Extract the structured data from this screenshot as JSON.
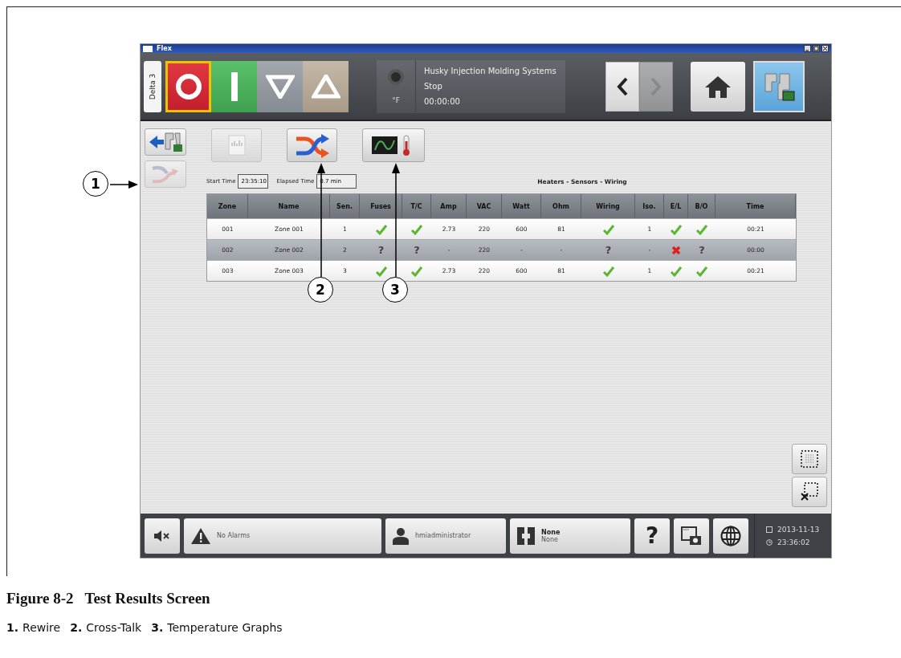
{
  "window": {
    "title": "Flex"
  },
  "header": {
    "side_tab": "Delta 3",
    "machine_buttons": [
      {
        "kind": "stop",
        "selected": true
      },
      {
        "kind": "start",
        "selected": false
      },
      {
        "kind": "down",
        "selected": false
      },
      {
        "kind": "up",
        "selected": false
      }
    ],
    "status": {
      "unit": "°F",
      "system": "Husky Injection Molding Systems",
      "state": "Stop",
      "time": "00:00:00"
    },
    "nav": {
      "back_disabled": false,
      "forward_disabled": true
    }
  },
  "left_buttons": [
    {
      "kind": "back",
      "disabled": false
    },
    {
      "kind": "rewire",
      "disabled": true
    }
  ],
  "toolbar": [
    {
      "kind": "report",
      "disabled": true
    },
    {
      "kind": "crosstalk",
      "disabled": false
    },
    {
      "kind": "graphs",
      "disabled": false
    }
  ],
  "start_time": {
    "label": "Start Time",
    "value": "23:35:10"
  },
  "elapsed_time": {
    "label": "Elapsed Time",
    "value": "0.7 min"
  },
  "table_title": "Heaters - Sensors - Wiring",
  "table": {
    "columns": [
      "Zone",
      "Name",
      "Sen.",
      "Fuses",
      "T/C",
      "Amp",
      "VAC",
      "Watt",
      "Ohm",
      "Wiring",
      "Iso.",
      "E/L",
      "B/O",
      "Time"
    ],
    "rows": [
      {
        "selected": false,
        "cells": [
          "001",
          "Zone 001",
          "1",
          {
            "kind": "check"
          },
          {
            "kind": "check"
          },
          "2.73",
          "220",
          "600",
          "81",
          {
            "kind": "check"
          },
          "1",
          {
            "kind": "check"
          },
          {
            "kind": "check"
          },
          "00:21"
        ]
      },
      {
        "selected": true,
        "cells": [
          "002",
          "Zone 002",
          "2",
          {
            "kind": "question",
            "text": "?"
          },
          {
            "kind": "question",
            "text": "?"
          },
          "-",
          "220",
          "-",
          "-",
          {
            "kind": "question",
            "text": "?"
          },
          "-",
          {
            "kind": "cross"
          },
          {
            "kind": "question",
            "text": "?"
          },
          "00:00"
        ]
      },
      {
        "selected": false,
        "cells": [
          "003",
          "Zone 003",
          "3",
          {
            "kind": "check"
          },
          {
            "kind": "check"
          },
          "2.73",
          "220",
          "600",
          "81",
          {
            "kind": "check"
          },
          "1",
          {
            "kind": "check"
          },
          {
            "kind": "check"
          },
          "00:21"
        ]
      }
    ]
  },
  "status_bar": {
    "alarms": "No Alarms",
    "user": "hmiadministrator",
    "mold_title": "None",
    "mold_sub": "None",
    "help": "?",
    "date": "2013-11-13",
    "time": "23:36:02"
  },
  "callouts": [
    "1",
    "2",
    "3"
  ],
  "caption": {
    "title": "Figure 8-2   Test Results Screen",
    "legend": [
      {
        "number": "1.",
        "label": "Rewire"
      },
      {
        "number": "2.",
        "label": "Cross-Talk"
      },
      {
        "number": "3.",
        "label": "Temperature Graphs"
      }
    ]
  }
}
